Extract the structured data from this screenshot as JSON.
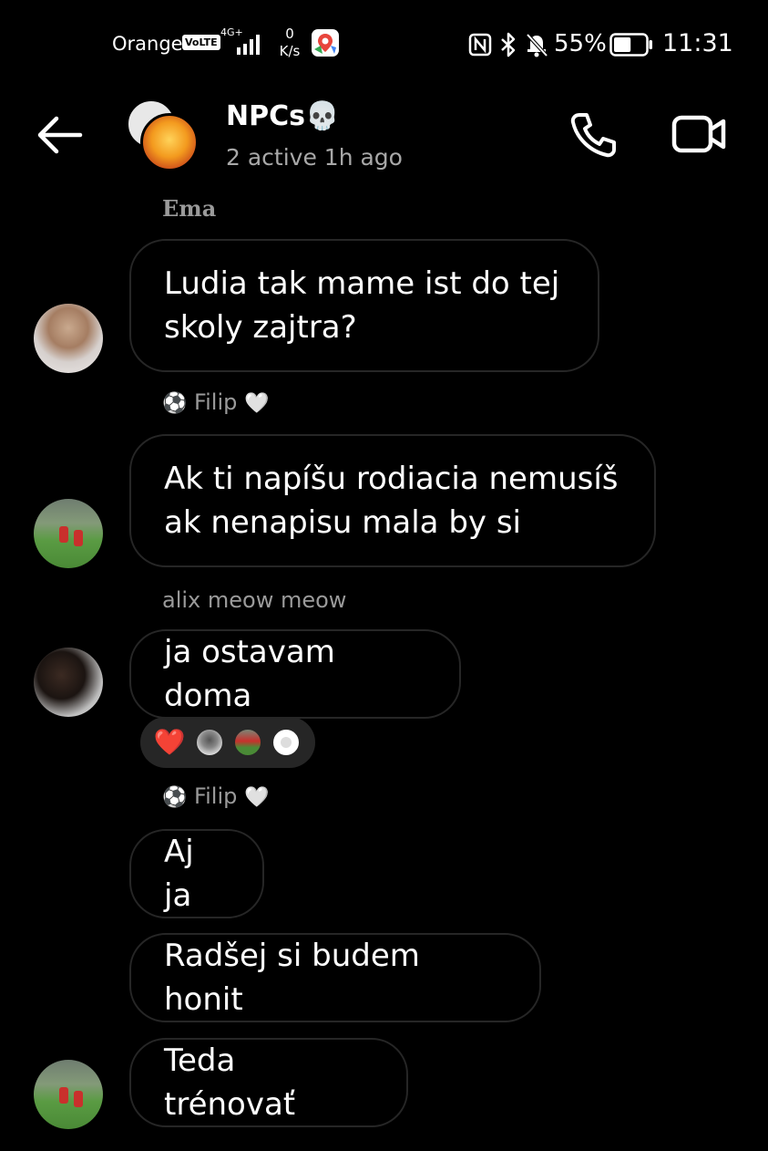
{
  "status_bar": {
    "carrier": "Orange",
    "volte": "VoLTE",
    "network": "4G+",
    "speed_value": "0",
    "speed_unit": "K/s",
    "battery_percent": "55%",
    "battery_level": 0.55,
    "time": "11:31",
    "icons": [
      "signal-icon",
      "maps-icon",
      "nfc-icon",
      "bluetooth-icon",
      "mute-icon",
      "battery-icon"
    ]
  },
  "header": {
    "back_icon": "arrow-left-icon",
    "title": "NPCs💀",
    "status": "2 active 1h ago",
    "call_icon": "phone-icon",
    "video_icon": "video-camera-icon"
  },
  "messages": [
    {
      "sender": "Ema",
      "text": "Ludia tak mame ist do tej\nskoly zajtra?"
    },
    {
      "sender_prefix": "⚽",
      "sender": "Filip",
      "sender_suffix": "🤍",
      "text": "Ak ti napíšu rodiacia nemusíš\nak nenapisu mala by si"
    },
    {
      "sender": "alix meow meow",
      "text": "ja ostavam doma",
      "reaction_emoji": "❤️"
    },
    {
      "sender_prefix": "⚽",
      "sender": "Filip",
      "sender_suffix": "🤍",
      "text": "Aj ja"
    },
    {
      "text": "Radšej si budem honit"
    },
    {
      "text": "Teda trénovať"
    }
  ],
  "colors": {
    "background": "#000000",
    "bubble_border": "#262626",
    "secondary_text": "#a8a8a8",
    "reaction_pill": "#262626"
  }
}
